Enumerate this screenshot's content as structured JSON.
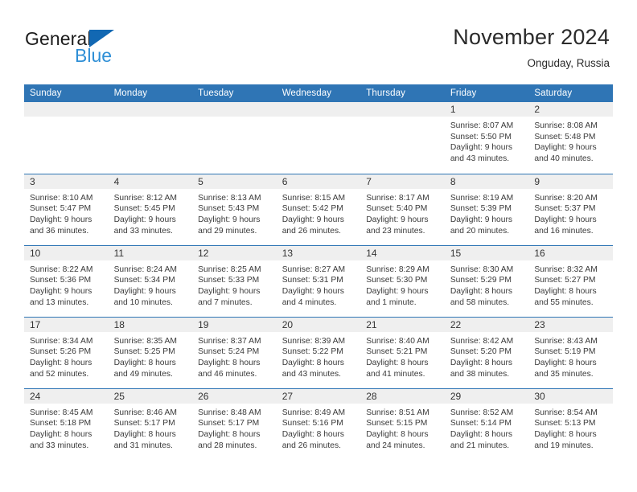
{
  "brand": {
    "name_part1": "General",
    "name_part2": "Blue",
    "triangle_color": "#1268b3",
    "blue_text_color": "#2f8fd6"
  },
  "header": {
    "title": "November 2024",
    "location": "Onguday, Russia"
  },
  "theme": {
    "header_blue": "#2f75b5",
    "day_band_gray": "#efefef",
    "text_color": "#3a3a3a"
  },
  "calendar": {
    "weekday_headers": [
      "Sunday",
      "Monday",
      "Tuesday",
      "Wednesday",
      "Thursday",
      "Friday",
      "Saturday"
    ],
    "weeks": [
      [
        {
          "day": "",
          "empty": true
        },
        {
          "day": "",
          "empty": true
        },
        {
          "day": "",
          "empty": true
        },
        {
          "day": "",
          "empty": true
        },
        {
          "day": "",
          "empty": true
        },
        {
          "day": "1",
          "sunrise": "Sunrise: 8:07 AM",
          "sunset": "Sunset: 5:50 PM",
          "daylight1": "Daylight: 9 hours",
          "daylight2": "and 43 minutes."
        },
        {
          "day": "2",
          "sunrise": "Sunrise: 8:08 AM",
          "sunset": "Sunset: 5:48 PM",
          "daylight1": "Daylight: 9 hours",
          "daylight2": "and 40 minutes."
        }
      ],
      [
        {
          "day": "3",
          "sunrise": "Sunrise: 8:10 AM",
          "sunset": "Sunset: 5:47 PM",
          "daylight1": "Daylight: 9 hours",
          "daylight2": "and 36 minutes."
        },
        {
          "day": "4",
          "sunrise": "Sunrise: 8:12 AM",
          "sunset": "Sunset: 5:45 PM",
          "daylight1": "Daylight: 9 hours",
          "daylight2": "and 33 minutes."
        },
        {
          "day": "5",
          "sunrise": "Sunrise: 8:13 AM",
          "sunset": "Sunset: 5:43 PM",
          "daylight1": "Daylight: 9 hours",
          "daylight2": "and 29 minutes."
        },
        {
          "day": "6",
          "sunrise": "Sunrise: 8:15 AM",
          "sunset": "Sunset: 5:42 PM",
          "daylight1": "Daylight: 9 hours",
          "daylight2": "and 26 minutes."
        },
        {
          "day": "7",
          "sunrise": "Sunrise: 8:17 AM",
          "sunset": "Sunset: 5:40 PM",
          "daylight1": "Daylight: 9 hours",
          "daylight2": "and 23 minutes."
        },
        {
          "day": "8",
          "sunrise": "Sunrise: 8:19 AM",
          "sunset": "Sunset: 5:39 PM",
          "daylight1": "Daylight: 9 hours",
          "daylight2": "and 20 minutes."
        },
        {
          "day": "9",
          "sunrise": "Sunrise: 8:20 AM",
          "sunset": "Sunset: 5:37 PM",
          "daylight1": "Daylight: 9 hours",
          "daylight2": "and 16 minutes."
        }
      ],
      [
        {
          "day": "10",
          "sunrise": "Sunrise: 8:22 AM",
          "sunset": "Sunset: 5:36 PM",
          "daylight1": "Daylight: 9 hours",
          "daylight2": "and 13 minutes."
        },
        {
          "day": "11",
          "sunrise": "Sunrise: 8:24 AM",
          "sunset": "Sunset: 5:34 PM",
          "daylight1": "Daylight: 9 hours",
          "daylight2": "and 10 minutes."
        },
        {
          "day": "12",
          "sunrise": "Sunrise: 8:25 AM",
          "sunset": "Sunset: 5:33 PM",
          "daylight1": "Daylight: 9 hours",
          "daylight2": "and 7 minutes."
        },
        {
          "day": "13",
          "sunrise": "Sunrise: 8:27 AM",
          "sunset": "Sunset: 5:31 PM",
          "daylight1": "Daylight: 9 hours",
          "daylight2": "and 4 minutes."
        },
        {
          "day": "14",
          "sunrise": "Sunrise: 8:29 AM",
          "sunset": "Sunset: 5:30 PM",
          "daylight1": "Daylight: 9 hours",
          "daylight2": "and 1 minute."
        },
        {
          "day": "15",
          "sunrise": "Sunrise: 8:30 AM",
          "sunset": "Sunset: 5:29 PM",
          "daylight1": "Daylight: 8 hours",
          "daylight2": "and 58 minutes."
        },
        {
          "day": "16",
          "sunrise": "Sunrise: 8:32 AM",
          "sunset": "Sunset: 5:27 PM",
          "daylight1": "Daylight: 8 hours",
          "daylight2": "and 55 minutes."
        }
      ],
      [
        {
          "day": "17",
          "sunrise": "Sunrise: 8:34 AM",
          "sunset": "Sunset: 5:26 PM",
          "daylight1": "Daylight: 8 hours",
          "daylight2": "and 52 minutes."
        },
        {
          "day": "18",
          "sunrise": "Sunrise: 8:35 AM",
          "sunset": "Sunset: 5:25 PM",
          "daylight1": "Daylight: 8 hours",
          "daylight2": "and 49 minutes."
        },
        {
          "day": "19",
          "sunrise": "Sunrise: 8:37 AM",
          "sunset": "Sunset: 5:24 PM",
          "daylight1": "Daylight: 8 hours",
          "daylight2": "and 46 minutes."
        },
        {
          "day": "20",
          "sunrise": "Sunrise: 8:39 AM",
          "sunset": "Sunset: 5:22 PM",
          "daylight1": "Daylight: 8 hours",
          "daylight2": "and 43 minutes."
        },
        {
          "day": "21",
          "sunrise": "Sunrise: 8:40 AM",
          "sunset": "Sunset: 5:21 PM",
          "daylight1": "Daylight: 8 hours",
          "daylight2": "and 41 minutes."
        },
        {
          "day": "22",
          "sunrise": "Sunrise: 8:42 AM",
          "sunset": "Sunset: 5:20 PM",
          "daylight1": "Daylight: 8 hours",
          "daylight2": "and 38 minutes."
        },
        {
          "day": "23",
          "sunrise": "Sunrise: 8:43 AM",
          "sunset": "Sunset: 5:19 PM",
          "daylight1": "Daylight: 8 hours",
          "daylight2": "and 35 minutes."
        }
      ],
      [
        {
          "day": "24",
          "sunrise": "Sunrise: 8:45 AM",
          "sunset": "Sunset: 5:18 PM",
          "daylight1": "Daylight: 8 hours",
          "daylight2": "and 33 minutes."
        },
        {
          "day": "25",
          "sunrise": "Sunrise: 8:46 AM",
          "sunset": "Sunset: 5:17 PM",
          "daylight1": "Daylight: 8 hours",
          "daylight2": "and 31 minutes."
        },
        {
          "day": "26",
          "sunrise": "Sunrise: 8:48 AM",
          "sunset": "Sunset: 5:17 PM",
          "daylight1": "Daylight: 8 hours",
          "daylight2": "and 28 minutes."
        },
        {
          "day": "27",
          "sunrise": "Sunrise: 8:49 AM",
          "sunset": "Sunset: 5:16 PM",
          "daylight1": "Daylight: 8 hours",
          "daylight2": "and 26 minutes."
        },
        {
          "day": "28",
          "sunrise": "Sunrise: 8:51 AM",
          "sunset": "Sunset: 5:15 PM",
          "daylight1": "Daylight: 8 hours",
          "daylight2": "and 24 minutes."
        },
        {
          "day": "29",
          "sunrise": "Sunrise: 8:52 AM",
          "sunset": "Sunset: 5:14 PM",
          "daylight1": "Daylight: 8 hours",
          "daylight2": "and 21 minutes."
        },
        {
          "day": "30",
          "sunrise": "Sunrise: 8:54 AM",
          "sunset": "Sunset: 5:13 PM",
          "daylight1": "Daylight: 8 hours",
          "daylight2": "and 19 minutes."
        }
      ]
    ]
  }
}
